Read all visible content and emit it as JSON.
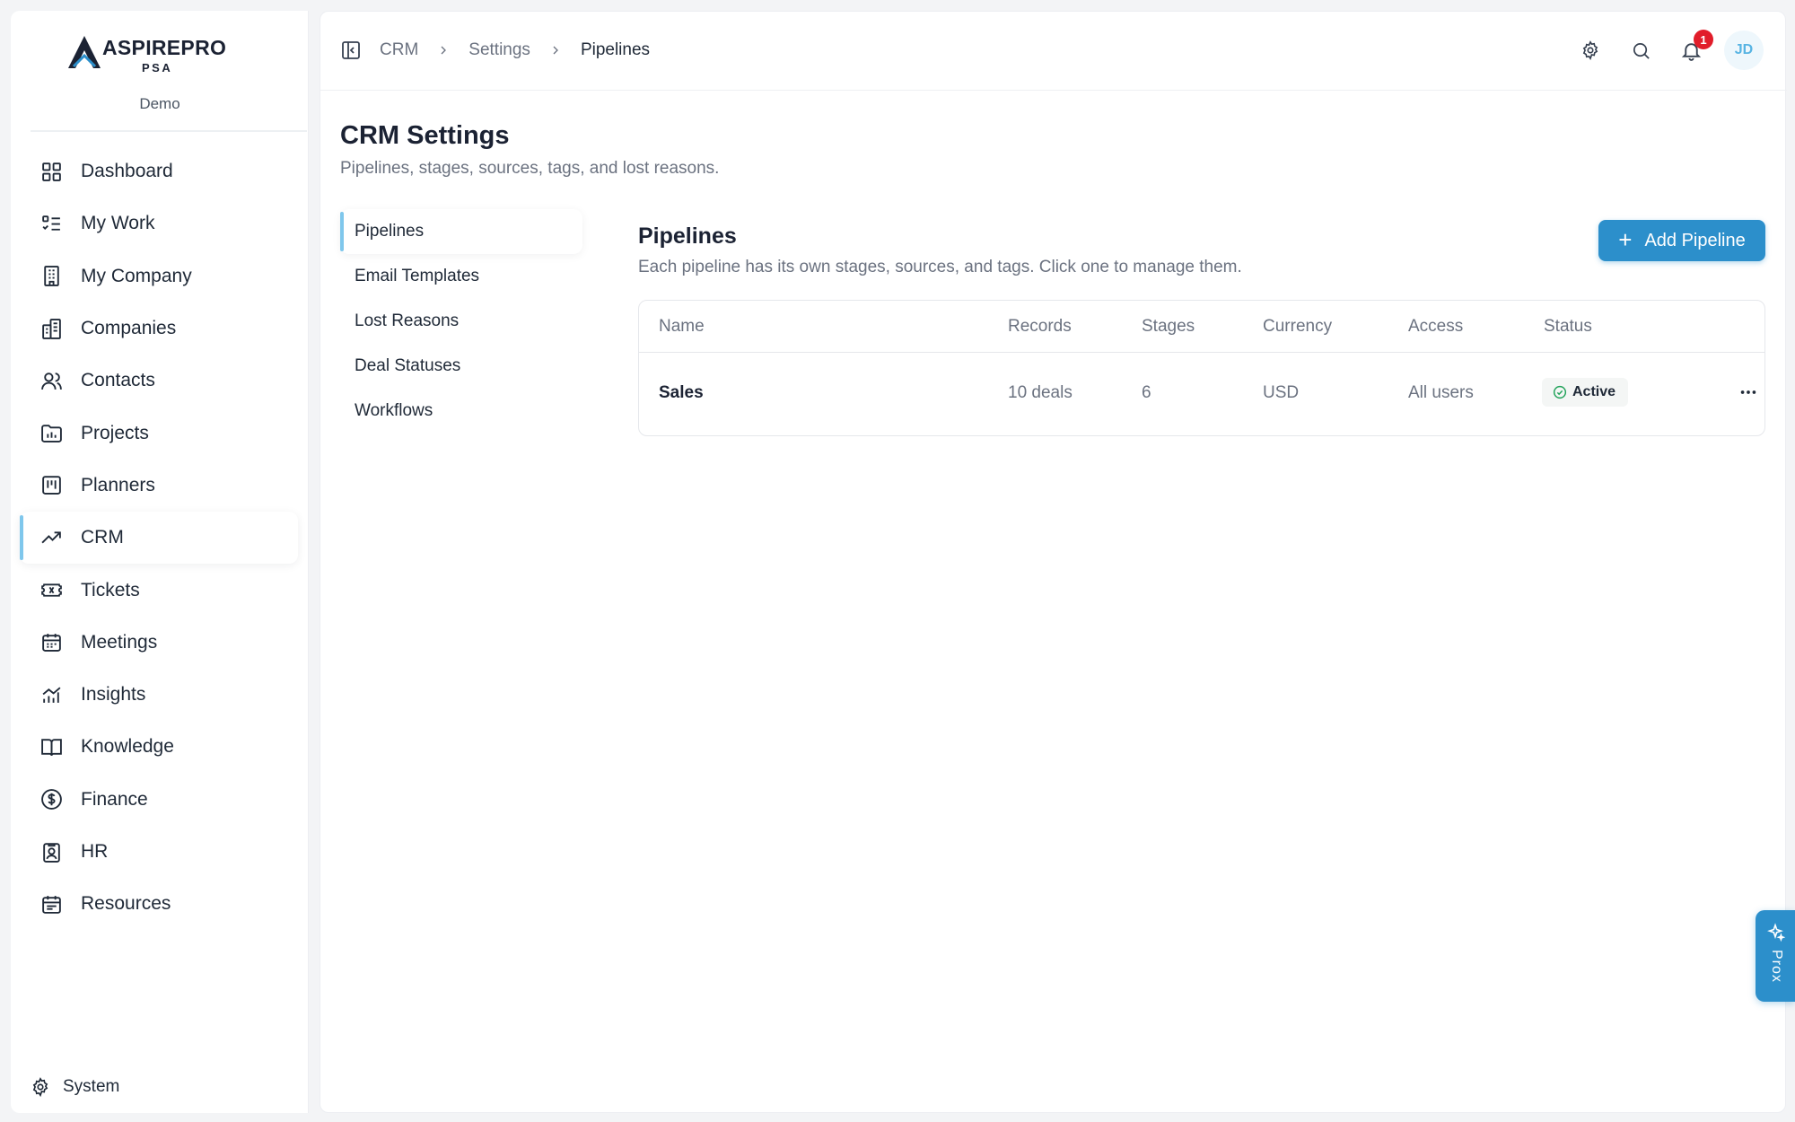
{
  "brand": {
    "name": "ASPIREPRO",
    "subtitle": "PSA",
    "org": "Demo",
    "accent": "#2c8fcb",
    "highlight": "#7fc7ec"
  },
  "sidebar": {
    "items": [
      {
        "label": "Dashboard",
        "icon": "grid-icon"
      },
      {
        "label": "My Work",
        "icon": "checklist-icon"
      },
      {
        "label": "My Company",
        "icon": "building-icon"
      },
      {
        "label": "Companies",
        "icon": "buildings-icon"
      },
      {
        "label": "Contacts",
        "icon": "users-icon"
      },
      {
        "label": "Projects",
        "icon": "folder-chart-icon"
      },
      {
        "label": "Planners",
        "icon": "kanban-icon"
      },
      {
        "label": "CRM",
        "icon": "trending-up-icon",
        "active": true
      },
      {
        "label": "Tickets",
        "icon": "ticket-icon"
      },
      {
        "label": "Meetings",
        "icon": "calendar-icon"
      },
      {
        "label": "Insights",
        "icon": "bar-chart-icon"
      },
      {
        "label": "Knowledge",
        "icon": "book-icon"
      },
      {
        "label": "Finance",
        "icon": "dollar-circle-icon"
      },
      {
        "label": "HR",
        "icon": "id-badge-icon"
      },
      {
        "label": "Resources",
        "icon": "calendar-list-icon"
      }
    ],
    "system_label": "System"
  },
  "topbar": {
    "breadcrumb": [
      "CRM",
      "Settings",
      "Pipelines"
    ],
    "notifications_count": "1",
    "avatar_initials": "JD"
  },
  "page": {
    "title": "CRM Settings",
    "subtitle": "Pipelines, stages, sources, tags, and lost reasons."
  },
  "subnav": {
    "items": [
      "Pipelines",
      "Email Templates",
      "Lost Reasons",
      "Deal Statuses",
      "Workflows"
    ],
    "active_index": 0
  },
  "pipelines": {
    "title": "Pipelines",
    "description": "Each pipeline has its own stages, sources, and tags. Click one to manage them.",
    "add_label": "Add Pipeline",
    "columns": [
      "Name",
      "Records",
      "Stages",
      "Currency",
      "Access",
      "Status"
    ],
    "rows": [
      {
        "name": "Sales",
        "records": "10 deals",
        "stages": "6",
        "currency": "USD",
        "access": "All users",
        "status": "Active",
        "status_color": "#22a35a"
      }
    ]
  },
  "assistant": {
    "label": "Prox"
  }
}
